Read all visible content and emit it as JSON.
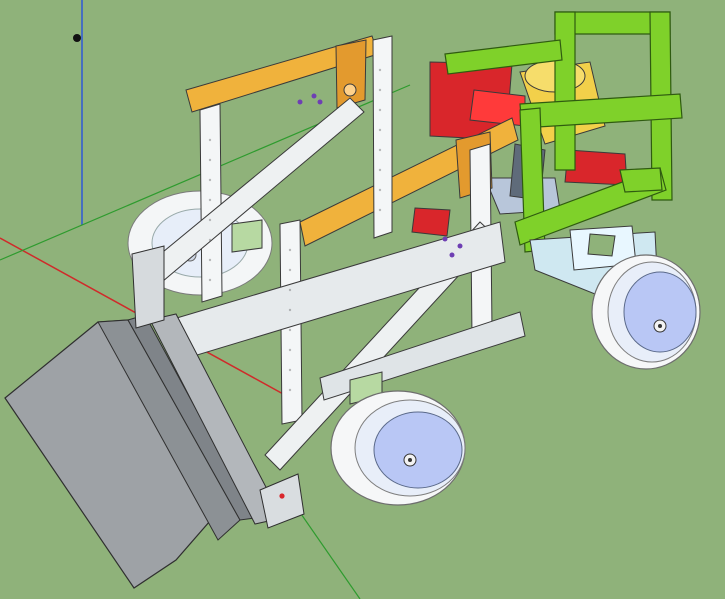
{
  "app": {
    "window_title": "",
    "tool": "pencil-icon"
  },
  "scene": {
    "background": "#8fb27a",
    "axes": {
      "red": "#d02a2a",
      "green": "#2e9b2e",
      "blue": "#2f59d8"
    },
    "palette": {
      "frame_white": "#f4f6f7",
      "frame_gray": "#c8cdd2",
      "orange_beam": "#f0b23c",
      "green_frame": "#7fd12a",
      "red_part": "#d9262b",
      "yellow_motor": "#f2d04a",
      "bucket_gray": "#9ea2a6",
      "wheel_white": "#f6f7f8",
      "hub_blue": "#b9c7f5",
      "bolt_purple": "#6e3fb3"
    },
    "model": "robot-loader"
  }
}
